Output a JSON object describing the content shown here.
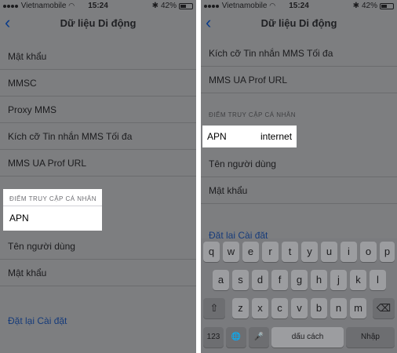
{
  "status": {
    "carrier": "Vietnamobile",
    "time": "15:24",
    "battery": "42%"
  },
  "nav": {
    "back": "‹",
    "title": "Dữ liệu Di động"
  },
  "left": {
    "rows": [
      "Mật khẩu",
      "MMSC",
      "Proxy MMS",
      "Kích cỡ Tin nhắn MMS Tối đa",
      "MMS UA Prof URL"
    ],
    "section_header": "ĐIỂM TRUY CẬP CÁ NHÂN",
    "apn_label": "APN",
    "rows_after": [
      "Tên người dùng",
      "Mật khẩu"
    ],
    "reset": "Đặt lại Cài đặt"
  },
  "right": {
    "rows": [
      "Kích cỡ Tin nhắn MMS Tối đa",
      "MMS UA Prof URL"
    ],
    "section_header": "ĐIỂM TRUY CẬP CÁ NHÂN",
    "apn_label": "APN",
    "apn_value": "internet",
    "rows_after": [
      "Tên người dùng",
      "Mật khẩu"
    ],
    "reset": "Đặt lại Cài đặt"
  },
  "keyboard": {
    "row1": [
      "q",
      "w",
      "e",
      "r",
      "t",
      "y",
      "u",
      "i",
      "o",
      "p"
    ],
    "row2": [
      "a",
      "s",
      "d",
      "f",
      "g",
      "h",
      "j",
      "k",
      "l"
    ],
    "row3": [
      "z",
      "x",
      "c",
      "v",
      "b",
      "n",
      "m"
    ],
    "shift": "⇧",
    "delete": "⌫",
    "numbers": "123",
    "globe": "🌐",
    "mic": "🎤",
    "space": "dấu cách",
    "enter": "Nhập"
  }
}
